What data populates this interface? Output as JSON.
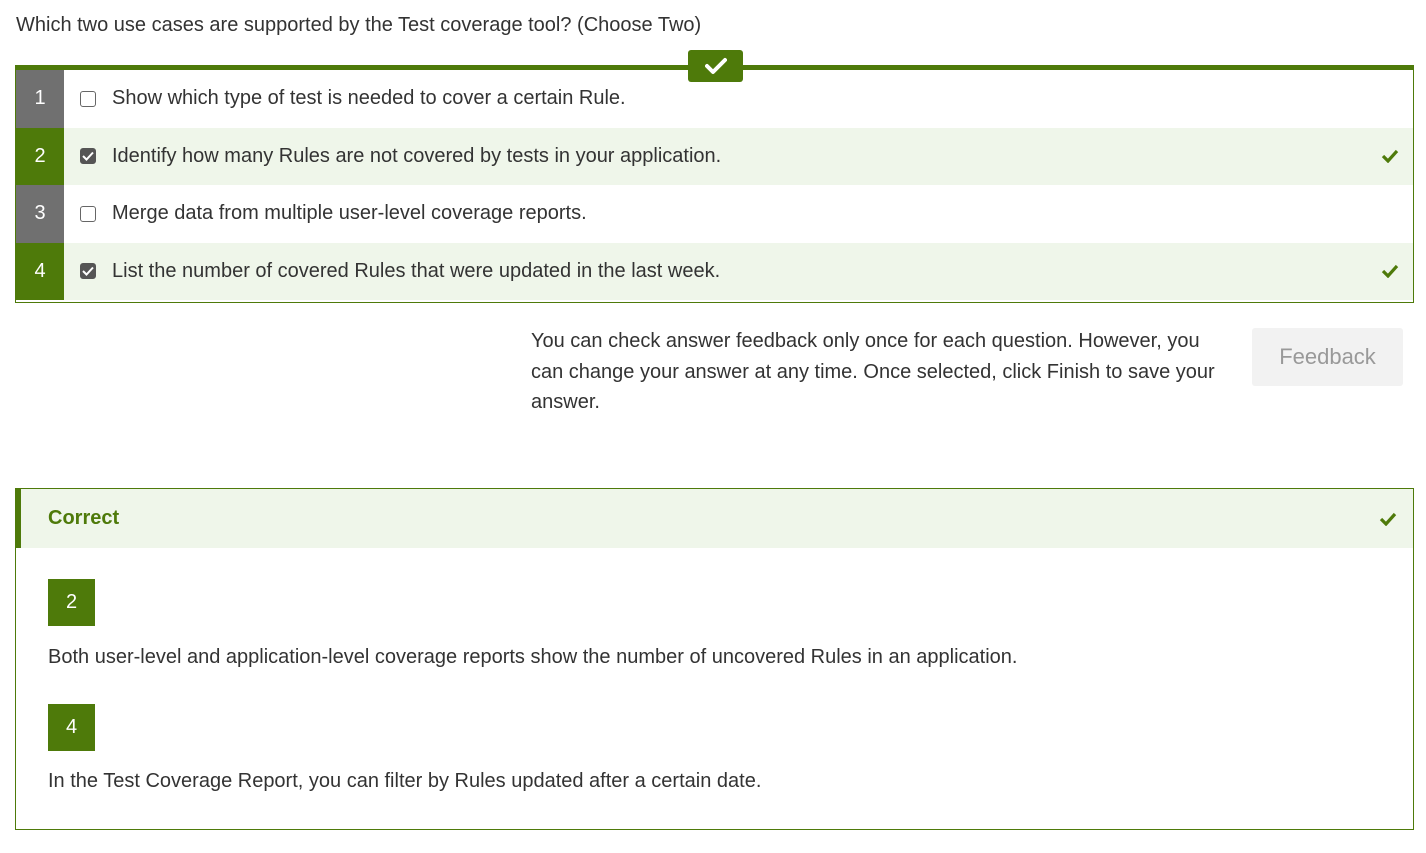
{
  "question": {
    "text": "Which two use cases are supported by the Test coverage tool? (Choose Two)"
  },
  "options": [
    {
      "number": "1",
      "text": "Show which type of test is needed to cover a certain Rule.",
      "checked": false,
      "correct": false
    },
    {
      "number": "2",
      "text": "Identify how many Rules are not covered by tests in your application.",
      "checked": true,
      "correct": true
    },
    {
      "number": "3",
      "text": "Merge data from multiple user-level coverage reports.",
      "checked": false,
      "correct": false
    },
    {
      "number": "4",
      "text": "List the number of covered Rules that were updated in the last week.",
      "checked": true,
      "correct": true
    }
  ],
  "feedback": {
    "note": "You can check answer feedback only once for each question. However, you can change your answer at any time. Once selected, click Finish to save your answer.",
    "button_label": "Feedback"
  },
  "result": {
    "title": "Correct",
    "explanations": [
      {
        "number": "2",
        "text": "Both user-level and application-level coverage reports show the number of uncovered Rules in an application."
      },
      {
        "number": "4",
        "text": "In the Test Coverage Report, you can filter by Rules updated after a certain date."
      }
    ]
  },
  "colors": {
    "accent": "#4e7a0a",
    "correct_bg": "#eff6ea",
    "unselected_num_bg": "#707070"
  },
  "icons": {
    "status": "check-icon",
    "row_correct": "check-icon"
  }
}
